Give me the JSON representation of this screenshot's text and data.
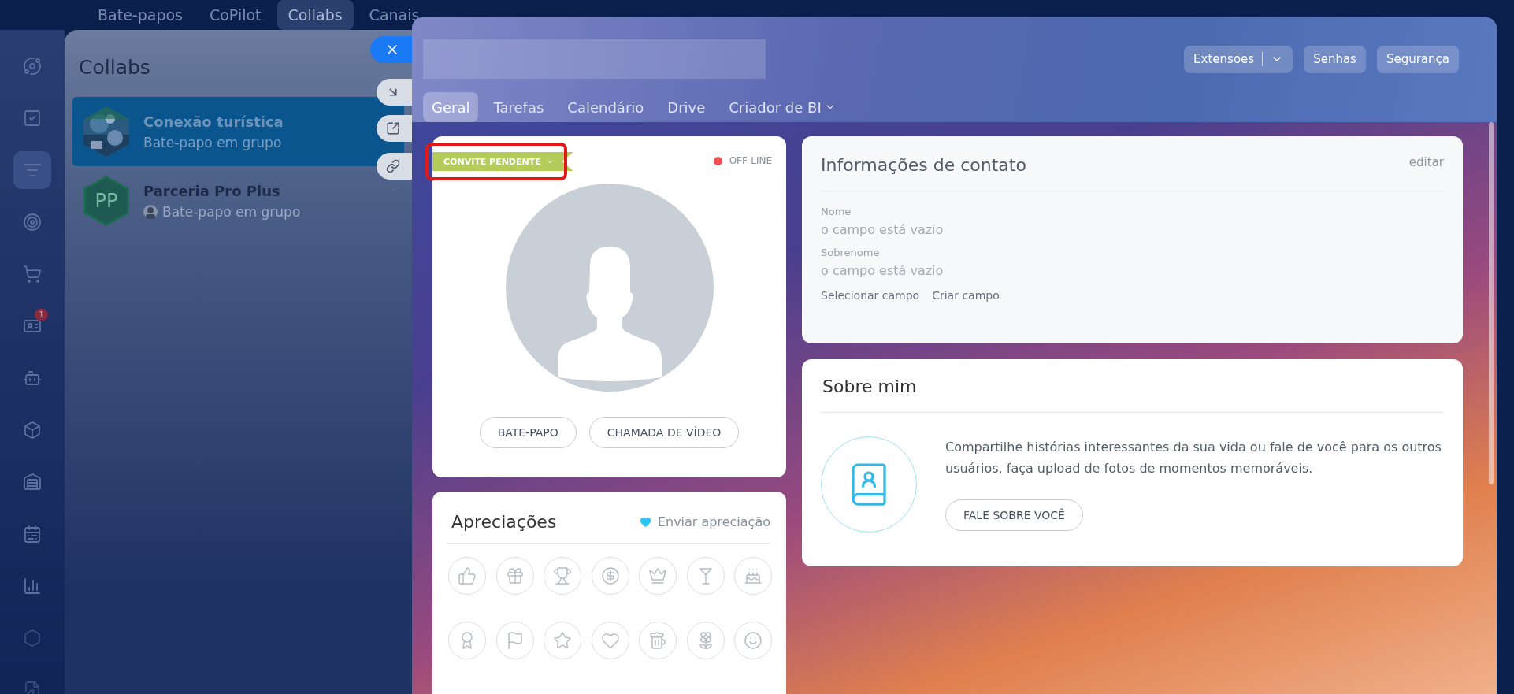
{
  "top_nav": {
    "tabs": [
      {
        "label": "Bate-papos",
        "selected": false
      },
      {
        "label": "CoPilot",
        "selected": false
      },
      {
        "label": "Collabs",
        "selected": true
      },
      {
        "label": "Canais",
        "selected": false
      }
    ]
  },
  "sidebar": {
    "items": [
      {
        "selected": false
      },
      {
        "selected": false
      },
      {
        "selected": true
      },
      {
        "selected": false
      },
      {
        "selected": false
      },
      {
        "selected": false,
        "badge": "1"
      },
      {
        "selected": false
      },
      {
        "selected": false
      },
      {
        "selected": false
      },
      {
        "selected": false
      },
      {
        "selected": false
      },
      {
        "selected": false
      },
      {
        "selected": false
      }
    ]
  },
  "collabs": {
    "title": "Collabs",
    "chats": [
      {
        "name": "Conexão turística",
        "subtitle": "Bate-papo em grupo",
        "selected": true
      },
      {
        "name": "Parceria Pro Plus",
        "subtitle": "Bate-papo em grupo",
        "selected": false,
        "avatar": {
          "kind": "initials",
          "text": "PP"
        },
        "read": true
      }
    ]
  },
  "profile": {
    "header_buttons": [
      {
        "label": "Extensões",
        "kind": "split"
      },
      {
        "label": "Senhas",
        "kind": "plain"
      },
      {
        "label": "Segurança",
        "kind": "plain"
      }
    ],
    "tabs": [
      {
        "label": "Geral",
        "selected": true,
        "dropdown": false
      },
      {
        "label": "Tarefas",
        "selected": false,
        "dropdown": false
      },
      {
        "label": "Calendário",
        "selected": false,
        "dropdown": false
      },
      {
        "label": "Drive",
        "selected": false,
        "dropdown": false
      },
      {
        "label": "Criador de BI",
        "selected": false,
        "dropdown": true
      }
    ],
    "card": {
      "status_badge": "CONVITE PENDENTE",
      "highlighted": true,
      "presence": {
        "label": "OFF-LINE",
        "color": "#f05252"
      },
      "buttons": [
        "BATE-PAPO",
        "CHAMADA DE VÍDEO"
      ]
    },
    "appreciations": {
      "title": "Apreciações",
      "send_link": "Enviar apreciação"
    },
    "contact": {
      "title": "Informações de contato",
      "edit": "editar",
      "fields": [
        {
          "label": "Nome",
          "value": "o campo está vazio"
        },
        {
          "label": "Sobrenome",
          "value": "o campo está vazio"
        }
      ],
      "links": [
        "Selecionar campo",
        "Criar campo"
      ]
    },
    "about": {
      "title": "Sobre mim",
      "text": "Compartilhe histórias interessantes da sua vida ou fale de você para os outros usuários, faça upload de fotos de momentos memoráveis.",
      "button": "FALE SOBRE VOCÊ"
    }
  }
}
